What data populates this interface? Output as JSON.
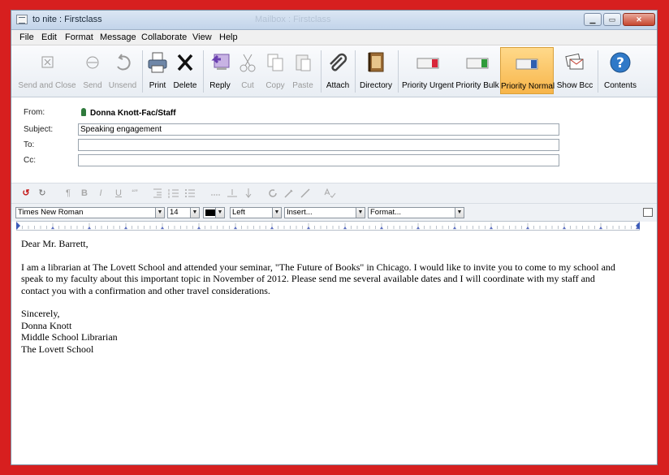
{
  "window": {
    "title": "to nite : Firstclass",
    "background_title": "Mailbox : Firstclass",
    "min_glyph": "▁",
    "max_glyph": "▭",
    "close_glyph": "✕"
  },
  "menu": [
    "File",
    "Edit",
    "Format",
    "Message",
    "Collaborate",
    "View",
    "Help"
  ],
  "toolbar": {
    "buttons": [
      {
        "label": "Send and Close",
        "icon": "send-and-close-icon",
        "enabled": false
      },
      {
        "label": "Send",
        "icon": "send-icon",
        "enabled": false
      },
      {
        "label": "Unsend",
        "icon": "unsend-icon",
        "enabled": false
      },
      {
        "label": "Print",
        "icon": "printer-icon",
        "enabled": true
      },
      {
        "label": "Delete",
        "icon": "delete-x-icon",
        "enabled": true
      },
      {
        "label": "Reply",
        "icon": "reply-icon",
        "enabled": true
      },
      {
        "label": "Cut",
        "icon": "scissors-icon",
        "enabled": false
      },
      {
        "label": "Copy",
        "icon": "copy-icon",
        "enabled": false
      },
      {
        "label": "Paste",
        "icon": "paste-icon",
        "enabled": false
      },
      {
        "label": "Attach",
        "icon": "paperclip-icon",
        "enabled": true
      },
      {
        "label": "Directory",
        "icon": "directory-book-icon",
        "enabled": true
      },
      {
        "label": "Priority Urgent",
        "icon": "priority-urgent-icon",
        "enabled": true
      },
      {
        "label": "Priority Bulk",
        "icon": "priority-bulk-icon",
        "enabled": true
      },
      {
        "label": "Priority Normal",
        "icon": "priority-normal-icon",
        "enabled": true,
        "active": true
      },
      {
        "label": "Show Bcc",
        "icon": "show-bcc-icon",
        "enabled": true
      },
      {
        "label": "Contents",
        "icon": "help-question-icon",
        "enabled": true
      }
    ],
    "active_color": "#f7b54a"
  },
  "header": {
    "from_label": "From:",
    "from_value": "Donna Knott-Fac/Staff",
    "subject_label": "Subject:",
    "subject_value": "Speaking engagement",
    "to_label": "To:",
    "to_value": "",
    "cc_label": "Cc:",
    "cc_value": ""
  },
  "format_toolbar": {
    "undo_glyph": "↺",
    "redo_glyph": "↻",
    "paragraph_glyph": "¶",
    "bold_glyph": "B",
    "italic_glyph": "I",
    "underline_glyph": "U",
    "quote_glyph": "“”"
  },
  "style_bar": {
    "font": "Times New Roman",
    "size": "14",
    "align": "Left",
    "insert": "Insert...",
    "format": "Format...",
    "color": "#000000"
  },
  "message": {
    "salutation": "Dear Mr. Barrett,",
    "paragraph_line1": "I am a librarian at The Lovett School and attended your seminar, \"The Future of Books\" in Chicago.  I would like to invite you to come to my school and",
    "paragraph_line2": "speak to my faculty about this important topic in November of 2012.  Please send me several available dates and I will coordinate with my staff and",
    "paragraph_line3": "contact you with a confirmation and other travel considerations.",
    "closing": "Sincerely,",
    "signature_name": "Donna Knott",
    "signature_title": "Middle School Librarian",
    "signature_org": "The Lovett School"
  }
}
